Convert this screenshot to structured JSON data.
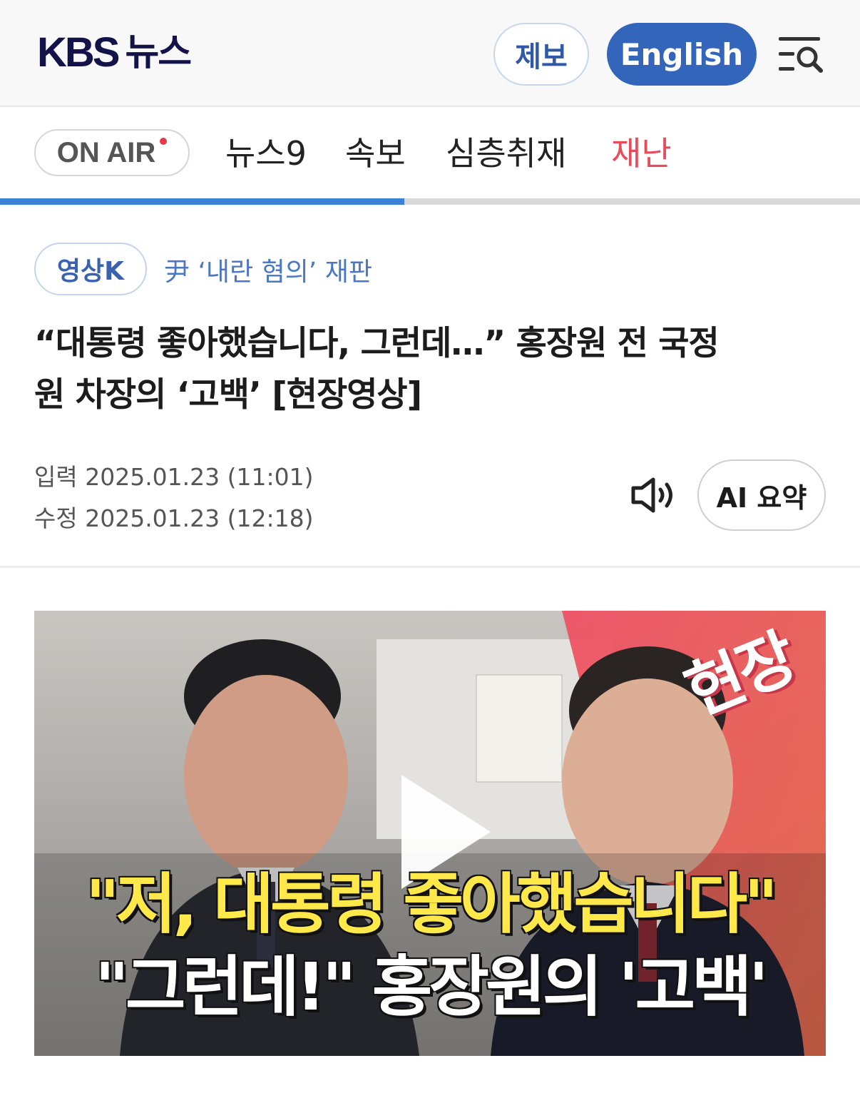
{
  "header": {
    "logo_main": "KBS",
    "logo_sub": "뉴스",
    "tip_label": "제보",
    "english_label": "English",
    "menu_icon": "menu-search-icon"
  },
  "nav": {
    "onair_label": "ON AIR",
    "items": [
      "뉴스9",
      "속보",
      "심층취재",
      "재난"
    ],
    "highlight_color": "#e84b5a",
    "scroll_progress": 0.47
  },
  "article": {
    "category": "영상K",
    "series": "尹 ‘내란 혐의’ 재판",
    "headline_line1": "“대통령 좋아했습니다, 그런데…” 홍장원 전 국정",
    "headline_line2": "원 차장의 ‘고백’ [현장영상]",
    "posted": "입력 2025.01.23 (11:01)",
    "modified": "수정 2025.01.23 (12:18)",
    "tts_icon": "speaker-icon",
    "ai_summary_label": "AI 요약"
  },
  "video": {
    "stamp": "현장",
    "caption_line1": "\"저, 대통령 좋아했습니다\"",
    "caption_line2": "\"그런데!\" 홍장원의 '고백'",
    "play_icon": "play-icon",
    "caption1_color": "#ffe84a",
    "accent_color": "#e8455a"
  }
}
